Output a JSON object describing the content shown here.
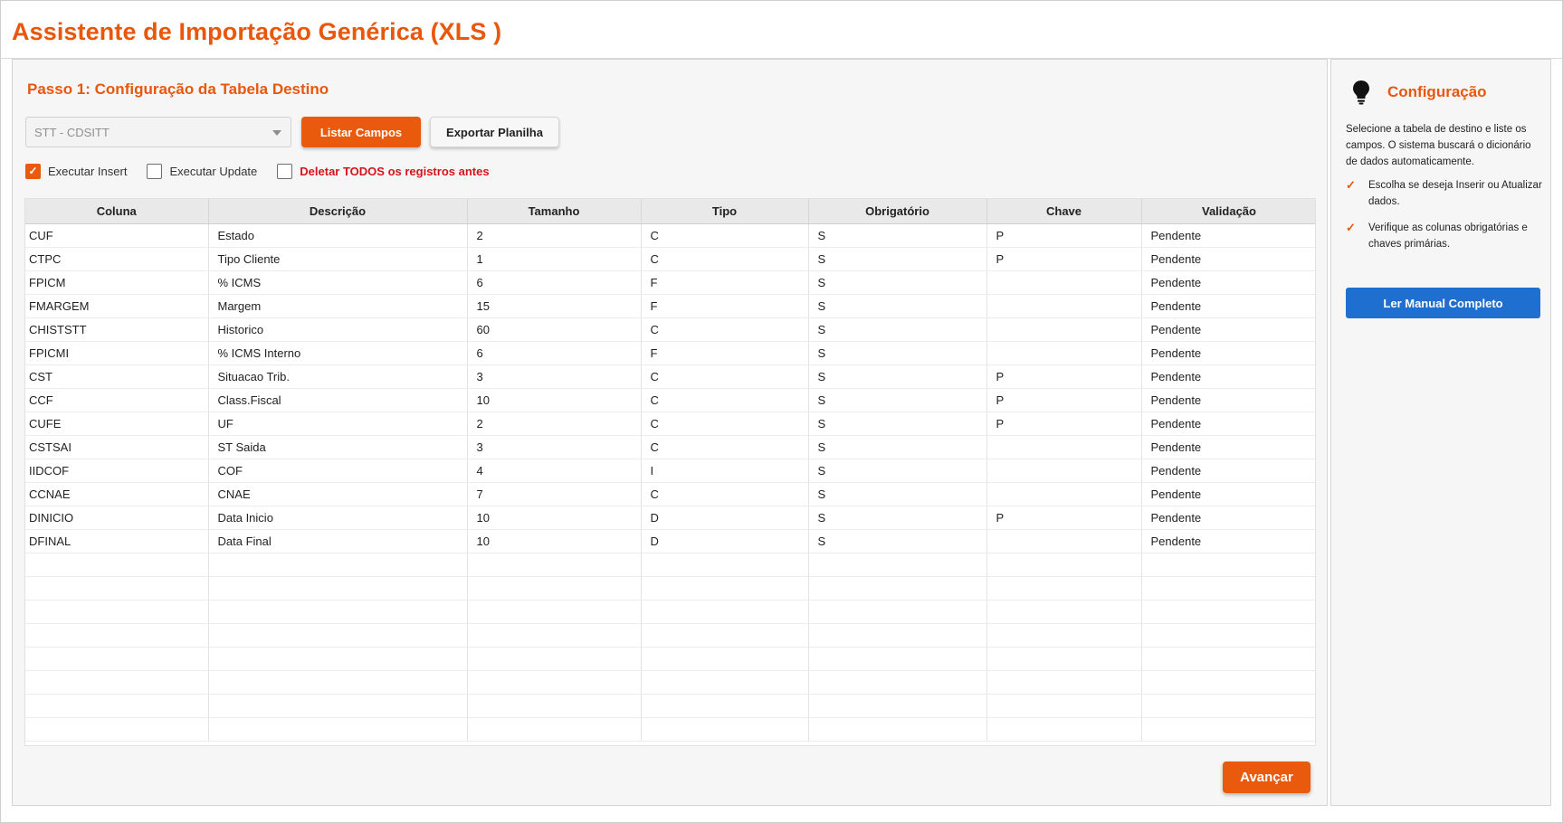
{
  "app": {
    "title": "Assistente de Importação Genérica (XLS )"
  },
  "step": {
    "title": "Passo 1: Configuração da Tabela Destino"
  },
  "toolbar": {
    "table_select_value": "STT - CDSITT",
    "list_fields_label": "Listar Campos",
    "export_label": "Exportar Planilha"
  },
  "options": {
    "insert_label": "Executar Insert",
    "insert_checked": true,
    "update_label": "Executar Update",
    "update_checked": false,
    "delete_all_label": "Deletar TODOS os registros antes",
    "delete_all_checked": false
  },
  "grid": {
    "columns": [
      "Coluna",
      "Descrição",
      "Tamanho",
      "Tipo",
      "Obrigatório",
      "Chave",
      "Validação"
    ],
    "rows": [
      [
        "CUF",
        "Estado",
        "2",
        "C",
        "S",
        "P",
        "Pendente"
      ],
      [
        "CTPC",
        "Tipo Cliente",
        "1",
        "C",
        "S",
        "P",
        "Pendente"
      ],
      [
        "FPICM",
        "% ICMS",
        "6",
        "F",
        "S",
        "",
        "Pendente"
      ],
      [
        "FMARGEM",
        "Margem",
        "15",
        "F",
        "S",
        "",
        "Pendente"
      ],
      [
        "CHISTSTT",
        "Historico",
        "60",
        "C",
        "S",
        "",
        "Pendente"
      ],
      [
        "FPICMI",
        "% ICMS Interno",
        "6",
        "F",
        "S",
        "",
        "Pendente"
      ],
      [
        "CST",
        "Situacao Trib.",
        "3",
        "C",
        "S",
        "P",
        "Pendente"
      ],
      [
        "CCF",
        "Class.Fiscal",
        "10",
        "C",
        "S",
        "P",
        "Pendente"
      ],
      [
        "CUFE",
        "UF",
        "2",
        "C",
        "S",
        "P",
        "Pendente"
      ],
      [
        "CSTSAI",
        "ST Saida",
        "3",
        "C",
        "S",
        "",
        "Pendente"
      ],
      [
        "IIDCOF",
        "COF",
        "4",
        "I",
        "S",
        "",
        "Pendente"
      ],
      [
        "CCNAE",
        "CNAE",
        "7",
        "C",
        "S",
        "",
        "Pendente"
      ],
      [
        "DINICIO",
        "Data Inicio",
        "10",
        "D",
        "S",
        "P",
        "Pendente"
      ],
      [
        "DFINAL",
        "Data Final",
        "10",
        "D",
        "S",
        "",
        "Pendente"
      ]
    ]
  },
  "footer": {
    "next_label": "Avançar"
  },
  "sidebar": {
    "title": "Configuração",
    "icon": "lightbulb-icon",
    "description": "Selecione a tabela de destino e liste os campos. O sistema buscará o dicionário de dados automaticamente.",
    "tips": [
      "Escolha se deseja Inserir ou Atualizar dados.",
      "Verifique as colunas obrigatórias e chaves primárias."
    ],
    "manual_label": "Ler Manual Completo"
  },
  "colors": {
    "accent": "#ea5a0c",
    "danger": "#d4141a",
    "link_button": "#1e6fcf"
  }
}
